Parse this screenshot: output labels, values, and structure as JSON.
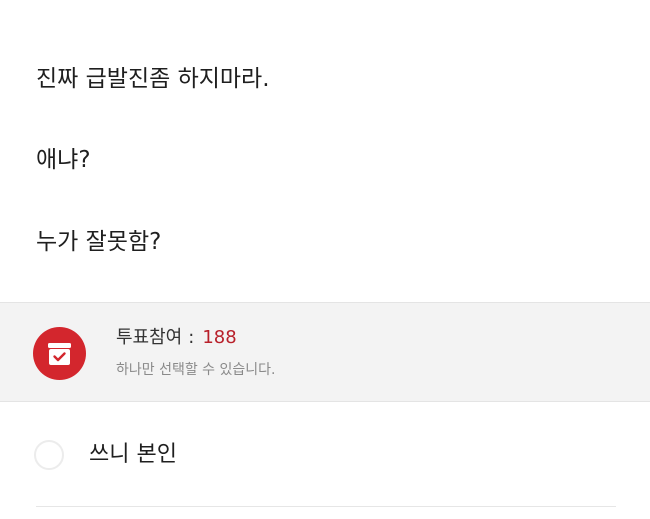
{
  "post": {
    "lines": [
      "진짜 급발진좀 하지마라.",
      "애냐?",
      "누가 잘못함?"
    ]
  },
  "poll": {
    "icon": "ballot-box-icon",
    "count_label": "투표참여",
    "count_separator": ":",
    "count_value": "188",
    "hint": "하나만 선택할 수 있습니다.",
    "accent_color": "#d3262d",
    "options": [
      {
        "label": "쓰니 본인",
        "selected": false
      }
    ]
  }
}
